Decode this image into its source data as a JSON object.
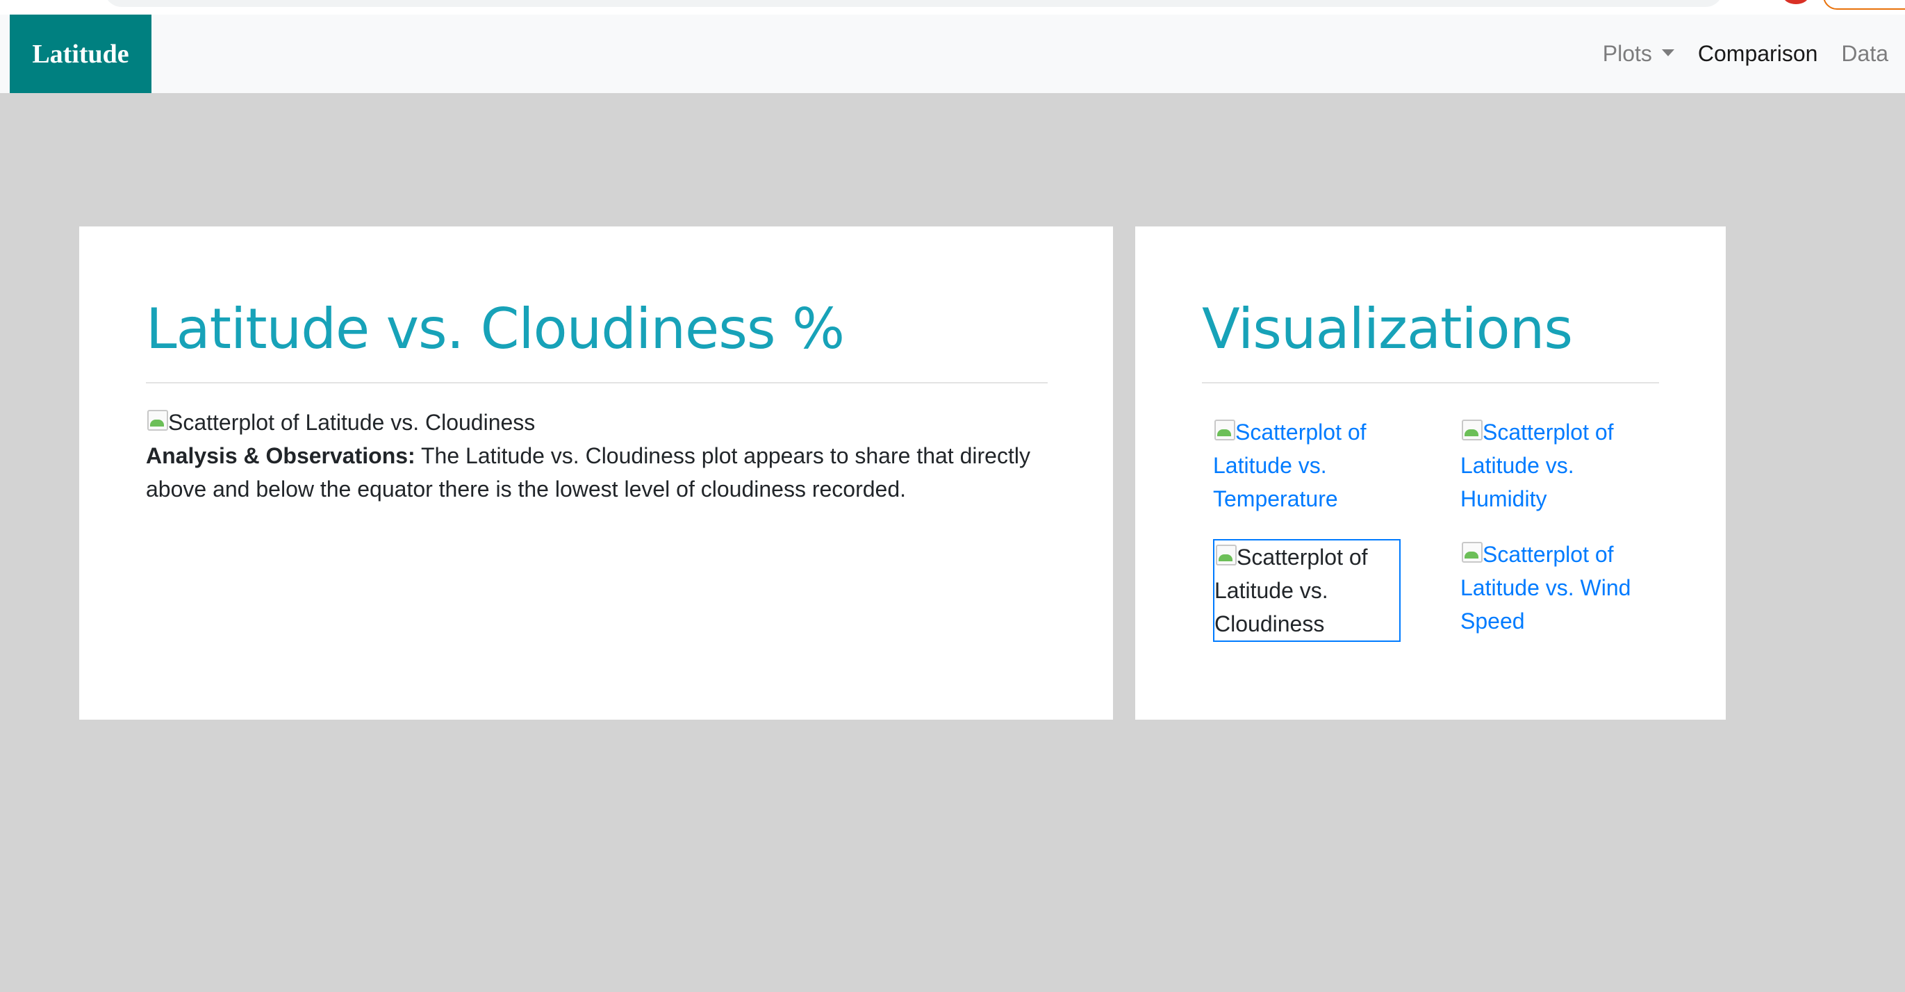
{
  "navbar": {
    "brand": "Latitude",
    "links": [
      {
        "label": "Plots",
        "dropdown": true
      },
      {
        "label": "Comparison"
      },
      {
        "label": "Data"
      }
    ]
  },
  "main_card": {
    "title": "Latitude vs. Cloudiness %",
    "image_alt": "Scatterplot of Latitude vs. Cloudiness",
    "analysis_label": "Analysis & Observations:",
    "analysis_text": " The Latitude vs. Cloudiness plot appears to share that directly above and below the equator there is the lowest level of cloudiness recorded."
  },
  "side_card": {
    "title": "Visualizations",
    "thumbnails": [
      {
        "alt": "Scatterplot of Latitude vs. Temperature"
      },
      {
        "alt": "Scatterplot of Latitude vs. Humidity"
      },
      {
        "alt": "Scatterplot of Latitude vs. Cloudiness"
      },
      {
        "alt": "Scatterplot of Latitude vs. Wind Speed"
      }
    ]
  },
  "colors": {
    "brand_bg": "#008080",
    "title": "#17a2b8",
    "link": "#007bff",
    "page_bg": "#d3d3d3"
  }
}
